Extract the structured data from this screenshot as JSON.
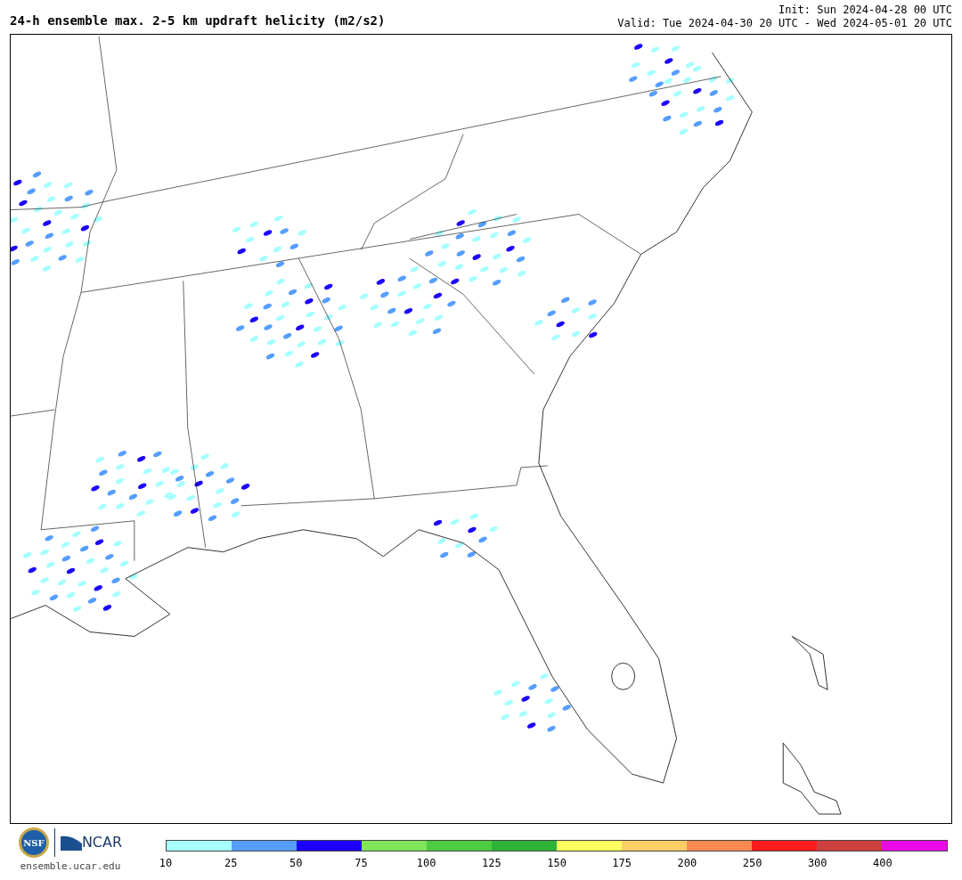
{
  "title": "24-h ensemble max. 2-5 km updraft helicity (m2/s2)",
  "init": "Init: Sun 2024-04-28 00 UTC",
  "valid": "Valid: Tue 2024-04-30 20 UTC - Wed 2024-05-01 20 UTC",
  "logos": {
    "nsf": "NSF",
    "ncar": "NCAR"
  },
  "site": "ensemble.ucar.edu",
  "colorbar": [
    {
      "label": "10",
      "color": "#a6ffff"
    },
    {
      "label": "25",
      "color": "#559dff"
    },
    {
      "label": "50",
      "color": "#1b00ff"
    },
    {
      "label": "75",
      "color": "#80e55c"
    },
    {
      "label": "100",
      "color": "#4dcc42"
    },
    {
      "label": "125",
      "color": "#2eb238"
    },
    {
      "label": "150",
      "color": "#fefe60"
    },
    {
      "label": "175",
      "color": "#fece66"
    },
    {
      "label": "200",
      "color": "#fe8a4f"
    },
    {
      "label": "250",
      "color": "#fe1c1c"
    },
    {
      "label": "300",
      "color": "#cc4040"
    },
    {
      "label": "400",
      "color": "#ea0aea"
    }
  ]
}
